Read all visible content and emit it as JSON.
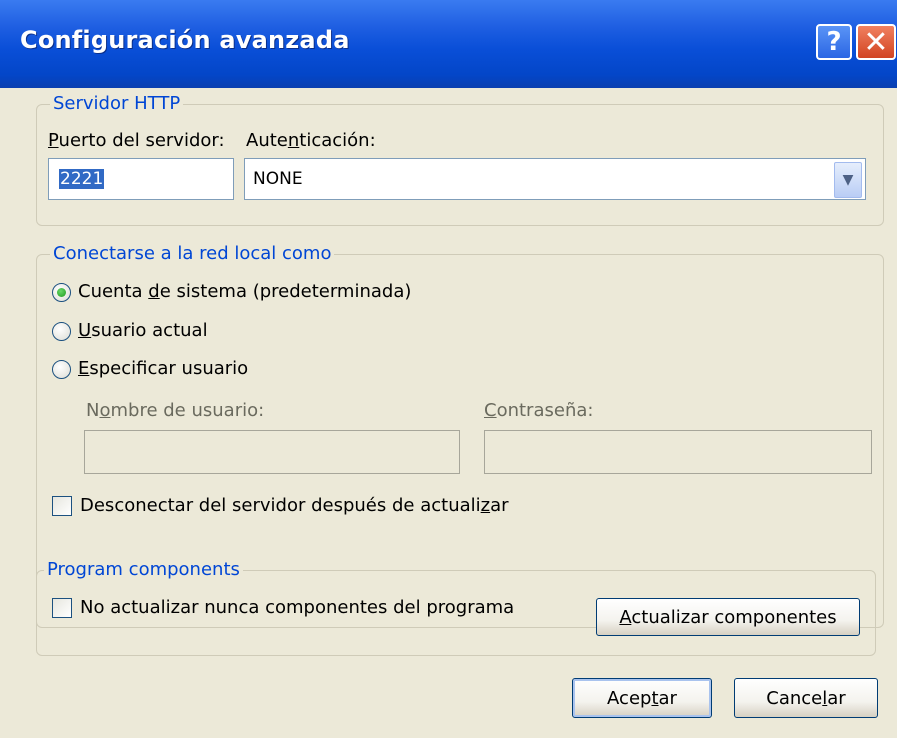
{
  "window": {
    "title": "Configuración avanzada",
    "help_glyph": "?",
    "close_glyph": "✕"
  },
  "http_server": {
    "legend": "Servidor HTTP",
    "port_label_u": "P",
    "port_label_rest": "uerto del servidor:",
    "port_value": "2221",
    "auth_label_a": "Aute",
    "auth_label_u": "n",
    "auth_label_b": "ticación:",
    "auth_value": "NONE"
  },
  "network": {
    "legend": "Conectarse a la red local como",
    "opt_system_a": "Cuenta ",
    "opt_system_u": "d",
    "opt_system_b": "e sistema (predeterminada)",
    "opt_current_u": "U",
    "opt_current_rest": "suario actual",
    "opt_specify_u": "E",
    "opt_specify_rest": "specificar usuario",
    "username_label_a": "N",
    "username_label_u": "o",
    "username_label_b": "mbre de usuario:",
    "password_label_u": "C",
    "password_label_rest": "ontraseña:",
    "disconnect_a": "Desconectar del servidor después de actuali",
    "disconnect_u": "z",
    "disconnect_b": "ar"
  },
  "components": {
    "legend": "Program components",
    "never_update": "No actualizar nunca componentes del programa",
    "update_btn_u": "A",
    "update_btn_rest": "ctualizar componentes"
  },
  "footer": {
    "ok_a": "Acep",
    "ok_u": "t",
    "ok_b": "ar",
    "cancel_a": "Cance",
    "cancel_u": "l",
    "cancel_b": "ar"
  }
}
